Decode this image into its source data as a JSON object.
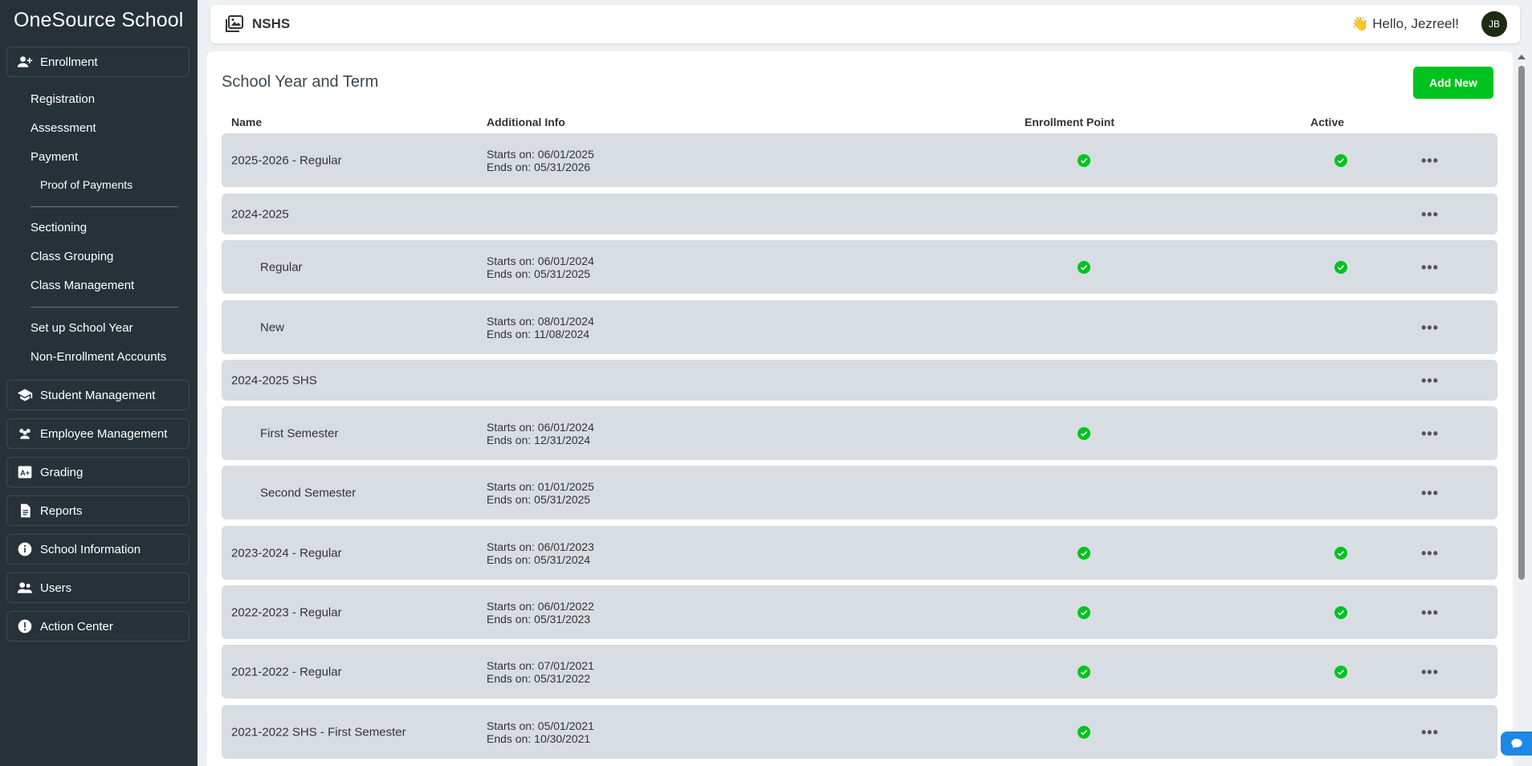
{
  "app": {
    "brand": "OneSource School"
  },
  "sidebar": {
    "groups": [
      {
        "label": "Enrollment",
        "icon": "user-plus-icon"
      },
      {
        "label": "Student Management",
        "icon": "graduation-cap-icon"
      },
      {
        "label": "Employee Management",
        "icon": "users-group-icon"
      },
      {
        "label": "Grading",
        "icon": "grade-a-plus-icon"
      },
      {
        "label": "Reports",
        "icon": "document-icon"
      },
      {
        "label": "School Information",
        "icon": "info-icon"
      },
      {
        "label": "Users",
        "icon": "users-icon"
      },
      {
        "label": "Action Center",
        "icon": "alert-icon"
      }
    ],
    "enrollment_items": [
      "Registration",
      "Assessment",
      "Payment",
      "Proof of Payments",
      "Sectioning",
      "Class Grouping",
      "Class Management",
      "Set up School Year",
      "Non-Enrollment Accounts"
    ]
  },
  "header": {
    "title": "NSHS",
    "greeting": "👋 Hello, Jezreel!",
    "avatar_initials": "JB"
  },
  "main": {
    "title": "School Year and Term",
    "add_label": "Add New",
    "columns": [
      "Name",
      "Additional Info",
      "Enrollment Point",
      "Active"
    ],
    "rows": [
      {
        "name": "2025-2026 - Regular",
        "starts": "Starts on: 06/01/2025",
        "ends": "Ends on: 05/31/2026",
        "enrollment_point": true,
        "active": true,
        "indent": false
      },
      {
        "name": "2024-2025",
        "starts": "",
        "ends": "",
        "enrollment_point": false,
        "active": false,
        "indent": false
      },
      {
        "name": "Regular",
        "starts": "Starts on: 06/01/2024",
        "ends": "Ends on: 05/31/2025",
        "enrollment_point": true,
        "active": true,
        "indent": true
      },
      {
        "name": "New",
        "starts": "Starts on: 08/01/2024",
        "ends": "Ends on: 11/08/2024",
        "enrollment_point": false,
        "active": false,
        "indent": true
      },
      {
        "name": "2024-2025 SHS",
        "starts": "",
        "ends": "",
        "enrollment_point": false,
        "active": false,
        "indent": false
      },
      {
        "name": "First Semester",
        "starts": "Starts on: 06/01/2024",
        "ends": "Ends on: 12/31/2024",
        "enrollment_point": true,
        "active": false,
        "indent": true
      },
      {
        "name": "Second Semester",
        "starts": "Starts on: 01/01/2025",
        "ends": "Ends on: 05/31/2025",
        "enrollment_point": false,
        "active": false,
        "indent": true
      },
      {
        "name": "2023-2024 - Regular",
        "starts": "Starts on: 06/01/2023",
        "ends": "Ends on: 05/31/2024",
        "enrollment_point": true,
        "active": true,
        "indent": false
      },
      {
        "name": "2022-2023 - Regular",
        "starts": "Starts on: 06/01/2022",
        "ends": "Ends on: 05/31/2023",
        "enrollment_point": true,
        "active": true,
        "indent": false
      },
      {
        "name": "2021-2022 - Regular",
        "starts": "Starts on: 07/01/2021",
        "ends": "Ends on: 05/31/2022",
        "enrollment_point": true,
        "active": true,
        "indent": false
      },
      {
        "name": "2021-2022 SHS - First Semester",
        "starts": "Starts on: 05/01/2021",
        "ends": "Ends on: 10/30/2021",
        "enrollment_point": true,
        "active": false,
        "indent": false
      }
    ]
  },
  "colors": {
    "sidebar": "#263238",
    "accent_green": "#00c31f",
    "row_bg": "#d7dde2"
  }
}
